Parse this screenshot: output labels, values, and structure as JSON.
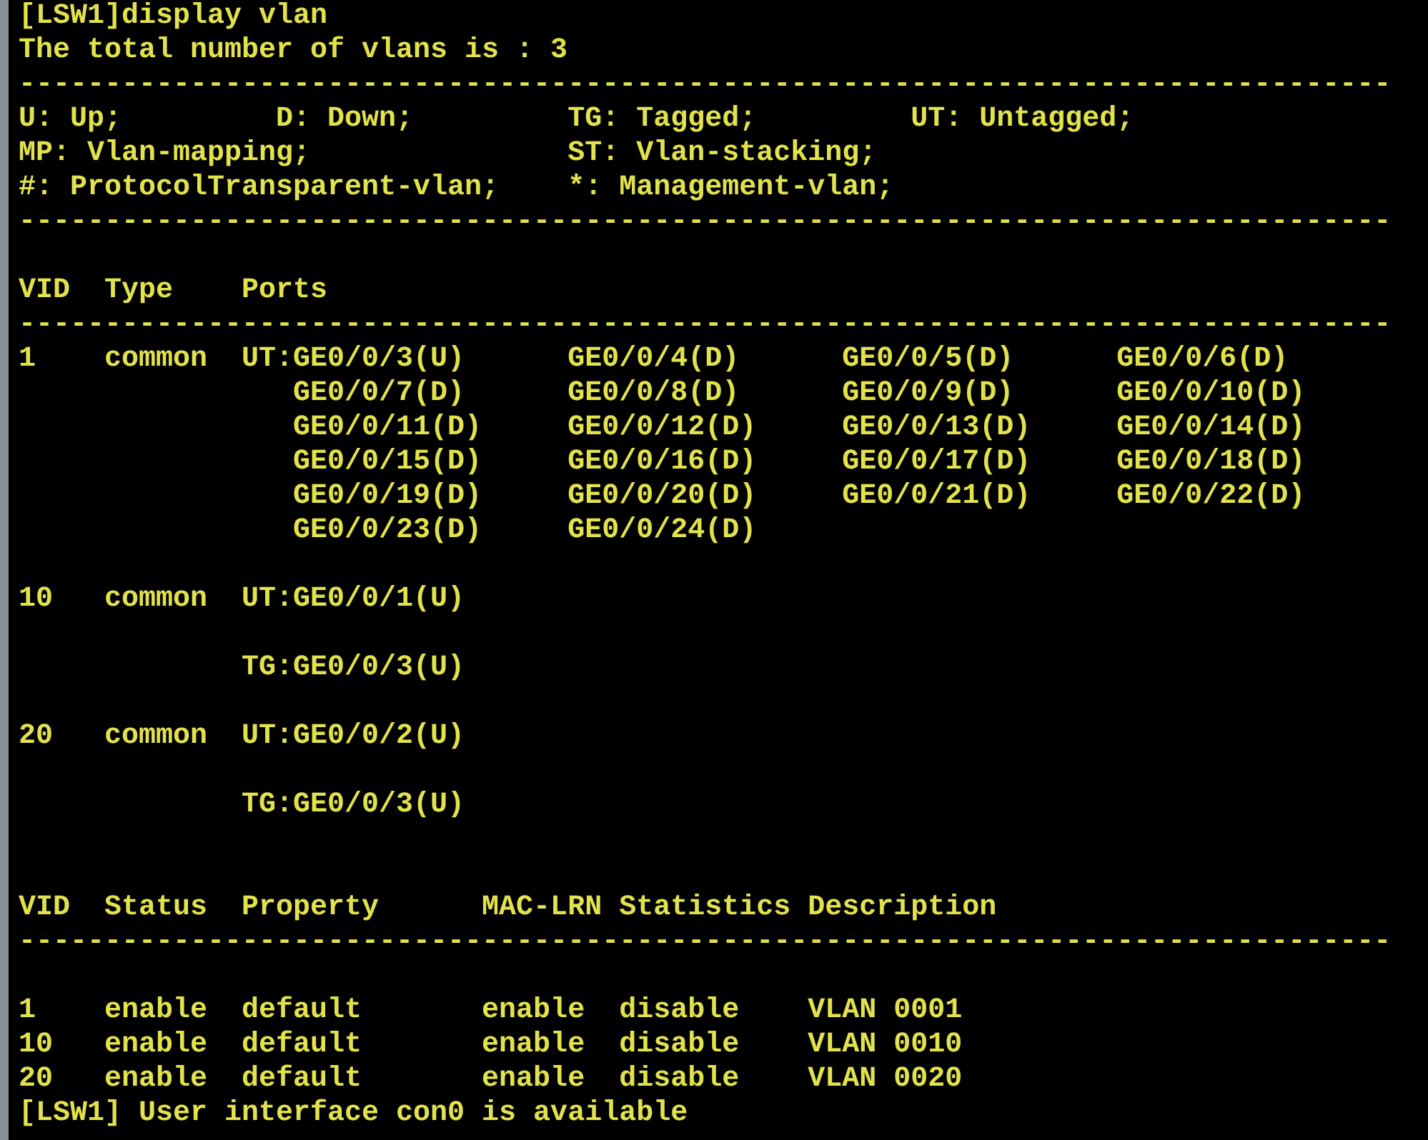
{
  "terminal": {
    "command": "[LSW1]display vlan",
    "summary": "The total number of vlans is : 3",
    "legend": {
      "rule": "--------------------------------------------------------------------------------",
      "lines": [
        "U: Up;         D: Down;         TG: Tagged;         UT: Untagged;",
        "MP: Vlan-mapping;               ST: Vlan-stacking;",
        "#: ProtocolTransparent-vlan;    *: Management-vlan;"
      ]
    },
    "port_table": {
      "header": "VID  Type    Ports",
      "rule": "--------------------------------------------------------------------------------",
      "entries": [
        {
          "lines": [
            "1    common  UT:GE0/0/3(U)      GE0/0/4(D)      GE0/0/5(D)      GE0/0/6(D)",
            "                GE0/0/7(D)      GE0/0/8(D)      GE0/0/9(D)      GE0/0/10(D)",
            "                GE0/0/11(D)     GE0/0/12(D)     GE0/0/13(D)     GE0/0/14(D)",
            "                GE0/0/15(D)     GE0/0/16(D)     GE0/0/17(D)     GE0/0/18(D)",
            "                GE0/0/19(D)     GE0/0/20(D)     GE0/0/21(D)     GE0/0/22(D)",
            "                GE0/0/23(D)     GE0/0/24(D)"
          ]
        },
        {
          "lines": [
            "10   common  UT:GE0/0/1(U)"
          ]
        },
        {
          "lines": [
            "             TG:GE0/0/3(U)"
          ]
        },
        {
          "lines": [
            "20   common  UT:GE0/0/2(U)"
          ]
        },
        {
          "lines": [
            "             TG:GE0/0/3(U)"
          ]
        }
      ]
    },
    "status_table": {
      "header": "VID  Status  Property      MAC-LRN Statistics Description",
      "rule": "--------------------------------------------------------------------------------",
      "rows": [
        "1    enable  default       enable  disable    VLAN 0001",
        "10   enable  default       enable  disable    VLAN 0010",
        "20   enable  default       enable  disable    VLAN 0020"
      ]
    },
    "message": "[LSW1] User interface con0 is available"
  }
}
